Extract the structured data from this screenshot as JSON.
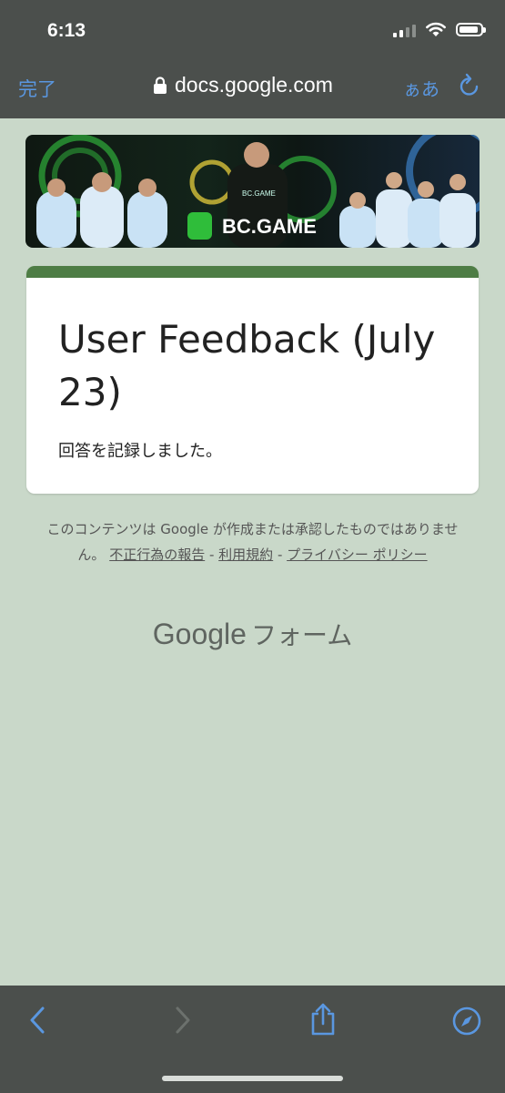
{
  "status": {
    "time": "6:13"
  },
  "browser": {
    "done_label": "完了",
    "url": "docs.google.com",
    "text_size_label": "ぁあ"
  },
  "banner": {
    "brand": "BC.GAME",
    "small_brand": "BC.GAME"
  },
  "form": {
    "title": "User Feedback (July 23)",
    "message": "回答を記録しました。",
    "accent_color": "#4e7d45"
  },
  "footer": {
    "disclaimer": "このコンテンツは Google が作成または承認したものではありません。",
    "report_link": "不正行為の報告",
    "terms_link": "利用規約",
    "privacy_link": "プライバシー ポリシー",
    "separator": " - ",
    "brand_google": "Google",
    "brand_forms": "フォーム"
  },
  "colors": {
    "page_bg": "#c9d8c9",
    "chrome_bg": "#4b4f4c",
    "link_blue": "#5a97e0"
  },
  "icons": [
    "lock-icon",
    "reload-icon",
    "back-icon",
    "forward-icon",
    "share-icon",
    "compass-icon",
    "wifi-icon",
    "battery-icon",
    "signal-icon"
  ]
}
